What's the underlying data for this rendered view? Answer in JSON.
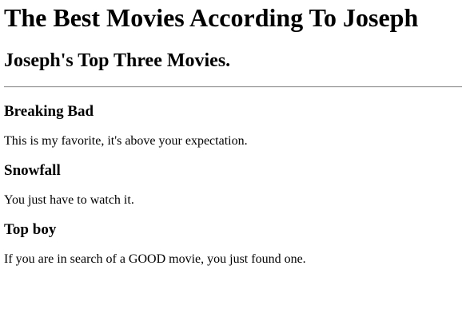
{
  "page": {
    "title": "The Best Movies According To Joseph",
    "subtitle": "Joseph's Top Three Movies."
  },
  "movies": [
    {
      "title": "Breaking Bad",
      "description": "This is my favorite, it's above your expectation."
    },
    {
      "title": "Snowfall",
      "description": "You just have to watch it."
    },
    {
      "title": "Top boy",
      "description": "If you are in search of a GOOD movie, you just found one."
    }
  ]
}
